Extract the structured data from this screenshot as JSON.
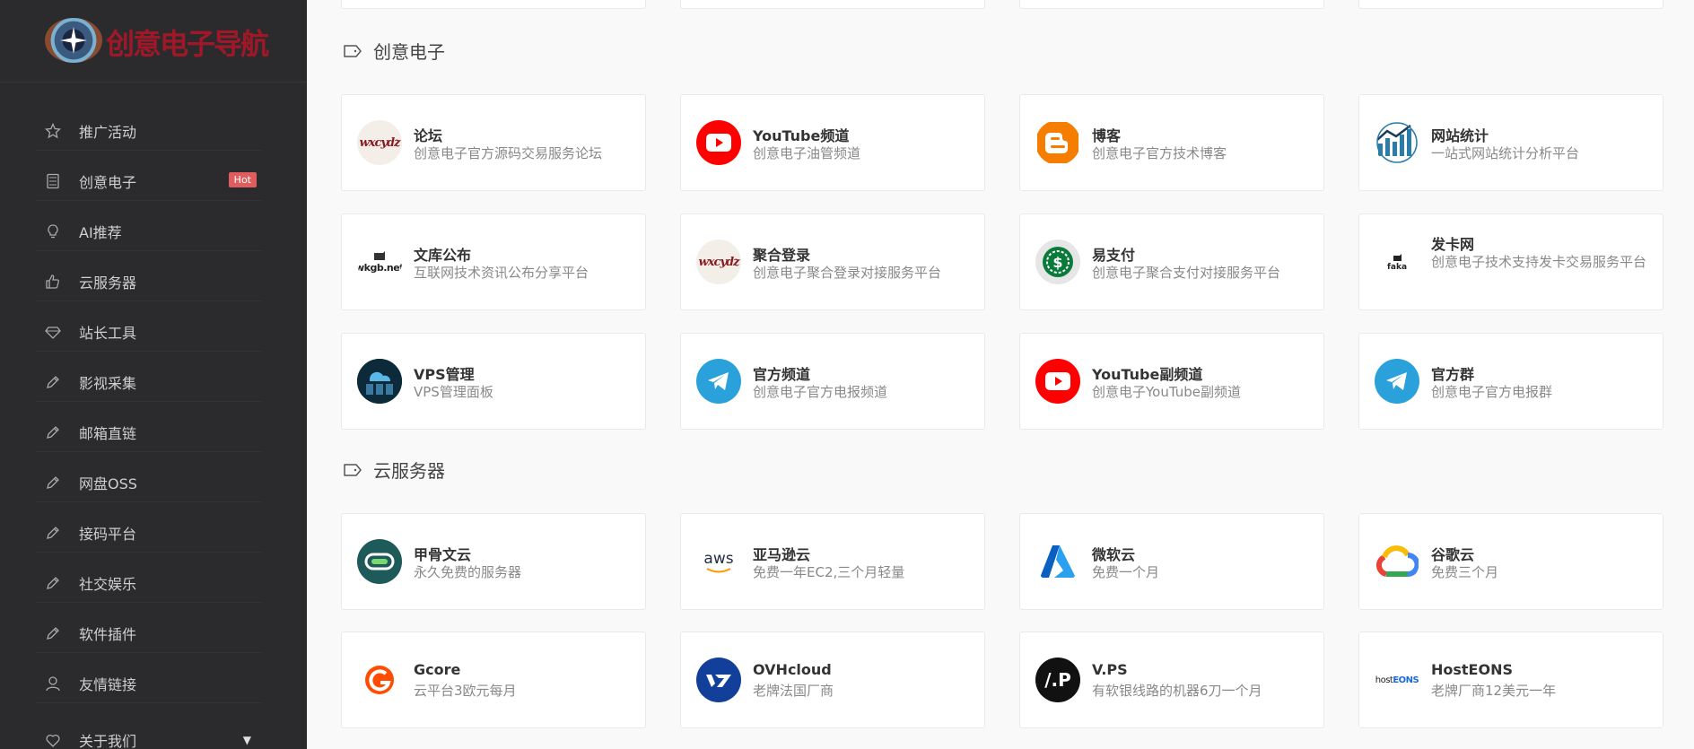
{
  "brand": {
    "logo_text": "创意电子导航"
  },
  "sidebar": {
    "items": [
      {
        "label": "推广活动",
        "icon": "star-icon"
      },
      {
        "label": "创意电子",
        "icon": "calculator-icon",
        "badge": "Hot"
      },
      {
        "label": "AI推荐",
        "icon": "lightbulb-icon"
      },
      {
        "label": "云服务器",
        "icon": "thumbs-up-icon"
      },
      {
        "label": "站长工具",
        "icon": "diamond-icon"
      },
      {
        "label": "影视采集",
        "icon": "pencil-icon"
      },
      {
        "label": "邮箱直链",
        "icon": "pencil-icon"
      },
      {
        "label": "网盘OSS",
        "icon": "pencil-icon"
      },
      {
        "label": "接码平台",
        "icon": "pencil-icon"
      },
      {
        "label": "社交娱乐",
        "icon": "pencil-icon"
      },
      {
        "label": "软件插件",
        "icon": "pencil-icon"
      },
      {
        "label": "友情链接",
        "icon": "user-icon"
      },
      {
        "label": "关于我们",
        "icon": "heart-icon",
        "caret": "▼"
      }
    ]
  },
  "sections": [
    {
      "title": "创意电子",
      "cards": [
        {
          "title": "论坛",
          "desc": "创意电子官方源码交易服务论坛",
          "icon": "wxcydz-logo-icon"
        },
        {
          "title": "YouTube频道",
          "desc": "创意电子油管频道",
          "icon": "youtube-icon"
        },
        {
          "title": "博客",
          "desc": "创意电子官方技术博客",
          "icon": "blogger-icon"
        },
        {
          "title": "网站统计",
          "desc": "一站式网站统计分析平台",
          "icon": "analytics-icon"
        },
        {
          "title": "文库公布",
          "desc": "互联网技术资讯公布分享平台",
          "icon": "wkgb-logo-icon"
        },
        {
          "title": "聚合登录",
          "desc": "创意电子聚合登录对接服务平台",
          "icon": "wxcydz-logo-icon"
        },
        {
          "title": "易支付",
          "desc": "创意电子聚合支付对接服务平台",
          "icon": "dollar-coin-icon"
        },
        {
          "title": "发卡网",
          "desc": "创意电子技术支持发卡交易服务平台",
          "icon": "faka-logo-icon"
        },
        {
          "title": "VPS管理",
          "desc": "VPS管理面板",
          "icon": "server-cloud-icon"
        },
        {
          "title": "官方频道",
          "desc": "创意电子官方电报频道",
          "icon": "telegram-icon"
        },
        {
          "title": "YouTube副频道",
          "desc": "创意电子YouTube副频道",
          "icon": "youtube-icon"
        },
        {
          "title": "官方群",
          "desc": "创意电子官方电报群",
          "icon": "telegram-icon"
        }
      ]
    },
    {
      "title": "云服务器",
      "cards": [
        {
          "title": "甲骨文云",
          "desc": "永久免费的服务器",
          "icon": "oracle-icon"
        },
        {
          "title": "亚马逊云",
          "desc": "免费一年EC2,三个月轻量",
          "icon": "aws-icon"
        },
        {
          "title": "微软云",
          "desc": "免费一个月",
          "icon": "azure-icon"
        },
        {
          "title": "谷歌云",
          "desc": "免费三个月",
          "icon": "google-cloud-icon"
        },
        {
          "title": "Gcore",
          "desc": "云平台3欧元每月",
          "icon": "gcore-icon"
        },
        {
          "title": "OVHcloud",
          "desc": "老牌法国厂商",
          "icon": "ovh-icon"
        },
        {
          "title": "V.PS",
          "desc": "有软银线路的机器6刀一个月",
          "icon": "vps-icon"
        },
        {
          "title": "HostEONS",
          "desc": "老牌厂商12美元一年",
          "icon": "hosteons-icon"
        }
      ]
    }
  ],
  "icon_texts": {
    "wxcydz": "wxcydz",
    "wkgb": "wkgb.net",
    "faka": "faka",
    "aws": "aws",
    "vps": "/.P",
    "hosteons_a": "host",
    "hosteons_b": "EONS"
  },
  "colors": {
    "sidebar_bg": "#2b2b2e",
    "hot_badge": "#e05d5d",
    "youtube": "#ff0000",
    "telegram": "#2aa1da",
    "blogger": "#f57d00"
  }
}
